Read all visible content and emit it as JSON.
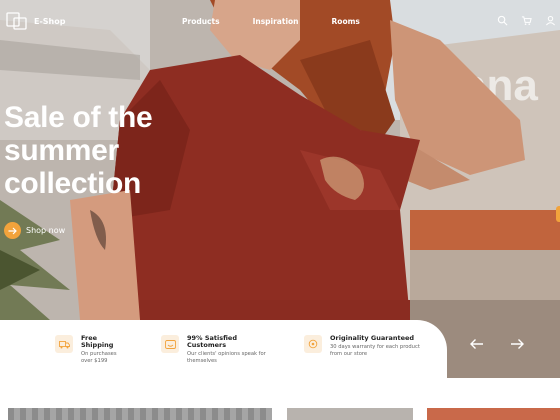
{
  "brand": {
    "name": "E-Shop",
    "accent": "#f2a33c"
  },
  "nav": {
    "links": [
      {
        "label": "Products"
      },
      {
        "label": "Inspiration"
      },
      {
        "label": "Rooms"
      }
    ],
    "icons": [
      "search-icon",
      "cart-icon",
      "user-icon"
    ]
  },
  "hero": {
    "headline_lines": [
      "Sale of the",
      "summer",
      "collection"
    ],
    "cta_label": "Shop now",
    "background_sign_text": "ana"
  },
  "features": [
    {
      "title": "Free Shipping",
      "desc": "On purchases over $199",
      "icon": "truck-icon"
    },
    {
      "title": "99% Satisfied Customers",
      "desc": "Our clients' opinions speak for themselves",
      "icon": "smile-icon"
    },
    {
      "title": "Originality Guaranteed",
      "desc": "30 days warranty for each product from our store",
      "icon": "badge-icon"
    }
  ],
  "slider": {
    "prev_icon": "arrow-left-icon",
    "next_icon": "arrow-right-icon"
  }
}
